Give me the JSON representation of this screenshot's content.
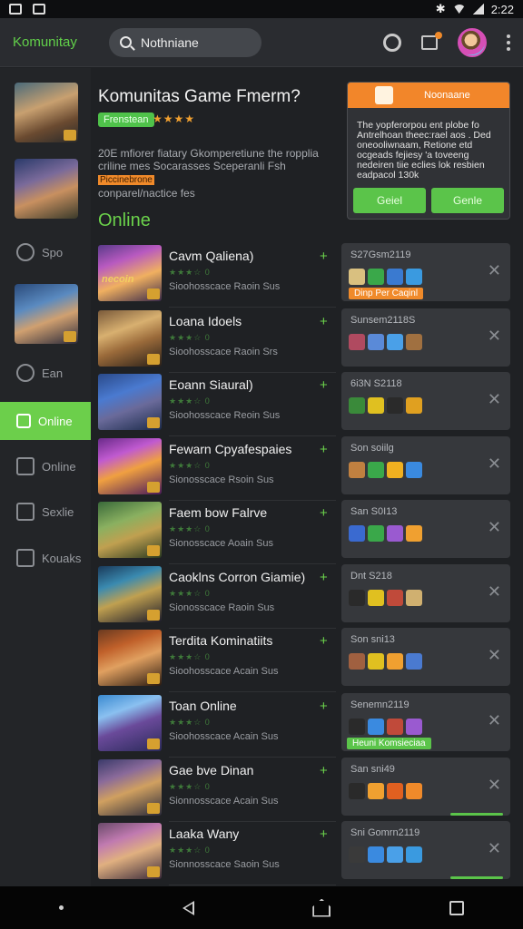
{
  "status_bar": {
    "time": "2:22"
  },
  "header": {
    "brand": "Komunitay",
    "search_value": "Nothniane",
    "search_placeholder": "Nothniane"
  },
  "sidebar": {
    "items": [
      {
        "label": "Spo",
        "icon": "wrench-icon"
      },
      {
        "label": "Ean",
        "icon": "search-icon"
      },
      {
        "label": "Online",
        "icon": "online-icon",
        "active": true
      },
      {
        "label": "Online",
        "icon": "square-icon"
      },
      {
        "label": "Sexlie",
        "icon": "box-x-icon"
      },
      {
        "label": "Kouaks",
        "icon": "k-icon"
      }
    ]
  },
  "featured": {
    "title": "Komunitas Game Fmerm?",
    "tag": "Frenstean",
    "stars": "★★★★",
    "desc_line1": "20E mfiorer fiatary Gkomperetiune the ropplia",
    "desc_line2": "criline mes Socarasses Sceperanli Fsh",
    "desc_highlight": "Piccinebrone",
    "desc_line3": "conparel/nactice fes"
  },
  "section_title": "Online",
  "notification": {
    "header": "Noonaane",
    "body_1": "The yopferorpou ent plobe fo",
    "body_2": "Antrelhoan theec:rael aos . Ded",
    "body_3": "oneooliwnaam, Retione etd",
    "body_4": "ocgeads fejiesy 'a toveeng",
    "body_5": "nedeiren tiie eclies lok resbien",
    "body_6": "eadpacol 130k",
    "button_1": "Geiel",
    "button_2": "Genle"
  },
  "rows": [
    {
      "name": "Cavm Qaliena)",
      "stars": "★★★☆ 0",
      "sub": "Sioohosscace Raoin Sus",
      "cover": "necoin",
      "card_title": "S27Gsm2119",
      "card_tag": "Dinp Per Caqinl",
      "card_tag_color": "#f08a2a",
      "colors": [
        "#d9c080",
        "#3aa84a",
        "#3a7ad0",
        "#3a9ae0"
      ]
    },
    {
      "name": "Loana Idoels",
      "stars": "★★★☆ 0",
      "sub": "Sioohosscace Raoin Srs",
      "cover": "",
      "card_title": "Sunsem2118S",
      "card_tag": "",
      "card_tag_color": "",
      "colors": [
        "#b04a60",
        "#5a8ad8",
        "#4aa0e8",
        "#a07040"
      ]
    },
    {
      "name": "Eoann Siaural)",
      "stars": "★★★☆ 0",
      "sub": "Sioohosscace Reoin Sus",
      "cover": "",
      "card_title": "6i3N S2118",
      "card_tag": "",
      "card_tag_color": "",
      "colors": [
        "#3a8a3a",
        "#e0c020",
        "#2a2a2a",
        "#e0a020"
      ]
    },
    {
      "name": "Fewarn Cpyafespaies",
      "stars": "★★★☆ 0",
      "sub": "Sionosscace Rsoin Sus",
      "cover": "",
      "card_title": "Son soiilg",
      "card_tag": "",
      "card_tag_color": "",
      "colors": [
        "#c08040",
        "#3aa84a",
        "#f0b020",
        "#3a8ae0"
      ]
    },
    {
      "name": "Faem bow Falrve",
      "stars": "★★★☆ 0",
      "sub": "Sionosscace Aoain Sus",
      "cover": "",
      "card_title": "San S0I13",
      "card_tag": "",
      "card_tag_color": "",
      "colors": [
        "#3a6ad0",
        "#3aa84a",
        "#9a5ad0",
        "#f0a030"
      ]
    },
    {
      "name": "Caoklns Corron Giamie)",
      "stars": "★★★☆ 0",
      "sub": "Sionosscace Raoin Sus",
      "cover": "",
      "card_title": "Dnt S218",
      "card_tag": "",
      "card_tag_color": "",
      "colors": [
        "#2a2a2a",
        "#e0c020",
        "#c04a3a",
        "#d0b070"
      ]
    },
    {
      "name": "Terdita Kominatiits",
      "stars": "★★★☆ 0",
      "sub": "Sioohosscace Acain Sus",
      "cover": "",
      "card_title": "Son sni13",
      "card_tag": "",
      "card_tag_color": "",
      "colors": [
        "#a06040",
        "#e0c020",
        "#f0a030",
        "#4a7ad0"
      ]
    },
    {
      "name": "Toan Online",
      "stars": "★★★☆ 0",
      "sub": "Sioohosscace Acain Sus",
      "cover": "",
      "card_title": "Senemn2119",
      "card_tag": "Heuni Komsieciaa",
      "card_tag_color": "#5bc44a",
      "colors": [
        "#2a2a2a",
        "#3a8ae0",
        "#c04a3a",
        "#9a5ad0"
      ]
    },
    {
      "name": "Gae bve Dinan",
      "stars": "★★★☆ 0",
      "sub": "Sionnosscace Acain Sus",
      "cover": "",
      "card_title": "San sni49",
      "card_tag": "",
      "card_tag_color": "",
      "colors": [
        "#2a2a2a",
        "#f0a030",
        "#e06020",
        "#f08a2a"
      ]
    },
    {
      "name": "Laaka Wany",
      "stars": "★★★☆ 0",
      "sub": "Sionnosscace Saoin Sus",
      "cover": "",
      "card_title": "Sni Gomrn2119",
      "card_tag": "",
      "card_tag_color": "",
      "colors": [
        "#3a3a3a",
        "#3a8ae0",
        "#4aa0e8",
        "#3a9ae0"
      ]
    }
  ]
}
